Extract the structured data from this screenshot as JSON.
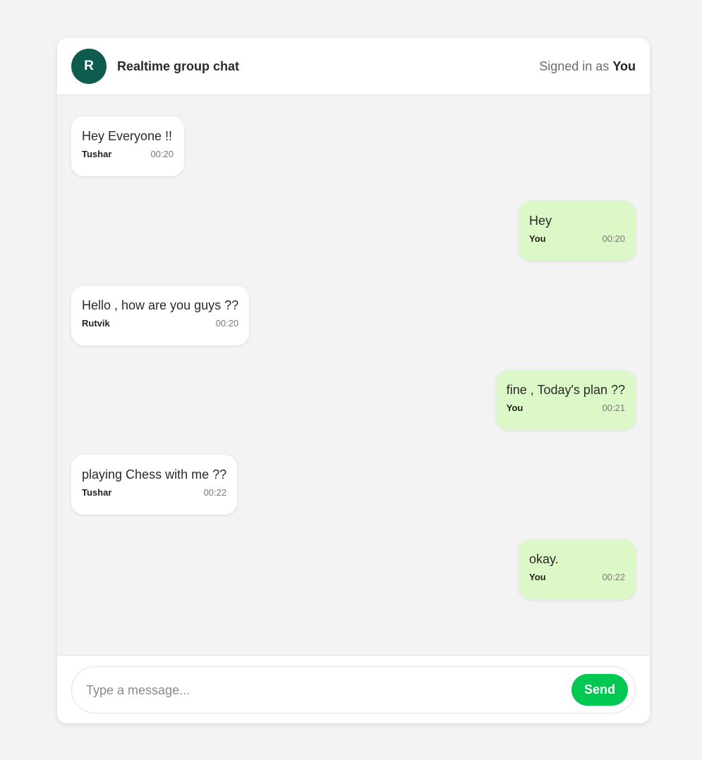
{
  "header": {
    "avatar_letter": "R",
    "title": "Realtime group chat",
    "signed_in_prefix": "Signed in as",
    "signed_in_user": "You"
  },
  "messages": [
    {
      "text": "Hey Everyone !!",
      "sender": "Tushar",
      "time": "00:20",
      "mine": false
    },
    {
      "text": "Hey",
      "sender": "You",
      "time": "00:20",
      "mine": true
    },
    {
      "text": "Hello , how are you guys ??",
      "sender": "Rutvik",
      "time": "00:20",
      "mine": false
    },
    {
      "text": "fine , Today's plan ??",
      "sender": "You",
      "time": "00:21",
      "mine": true
    },
    {
      "text": "playing Chess with me ??",
      "sender": "Tushar",
      "time": "00:22",
      "mine": false
    },
    {
      "text": "okay.",
      "sender": "You",
      "time": "00:22",
      "mine": true
    }
  ],
  "composer": {
    "placeholder": "Type a message...",
    "value": "",
    "send_label": "Send"
  },
  "colors": {
    "avatar": "#0d5c4f",
    "own_bubble": "#dcf8c6",
    "other_bubble": "#ffffff",
    "send_button": "#00c853",
    "background": "#f3f3f3"
  }
}
